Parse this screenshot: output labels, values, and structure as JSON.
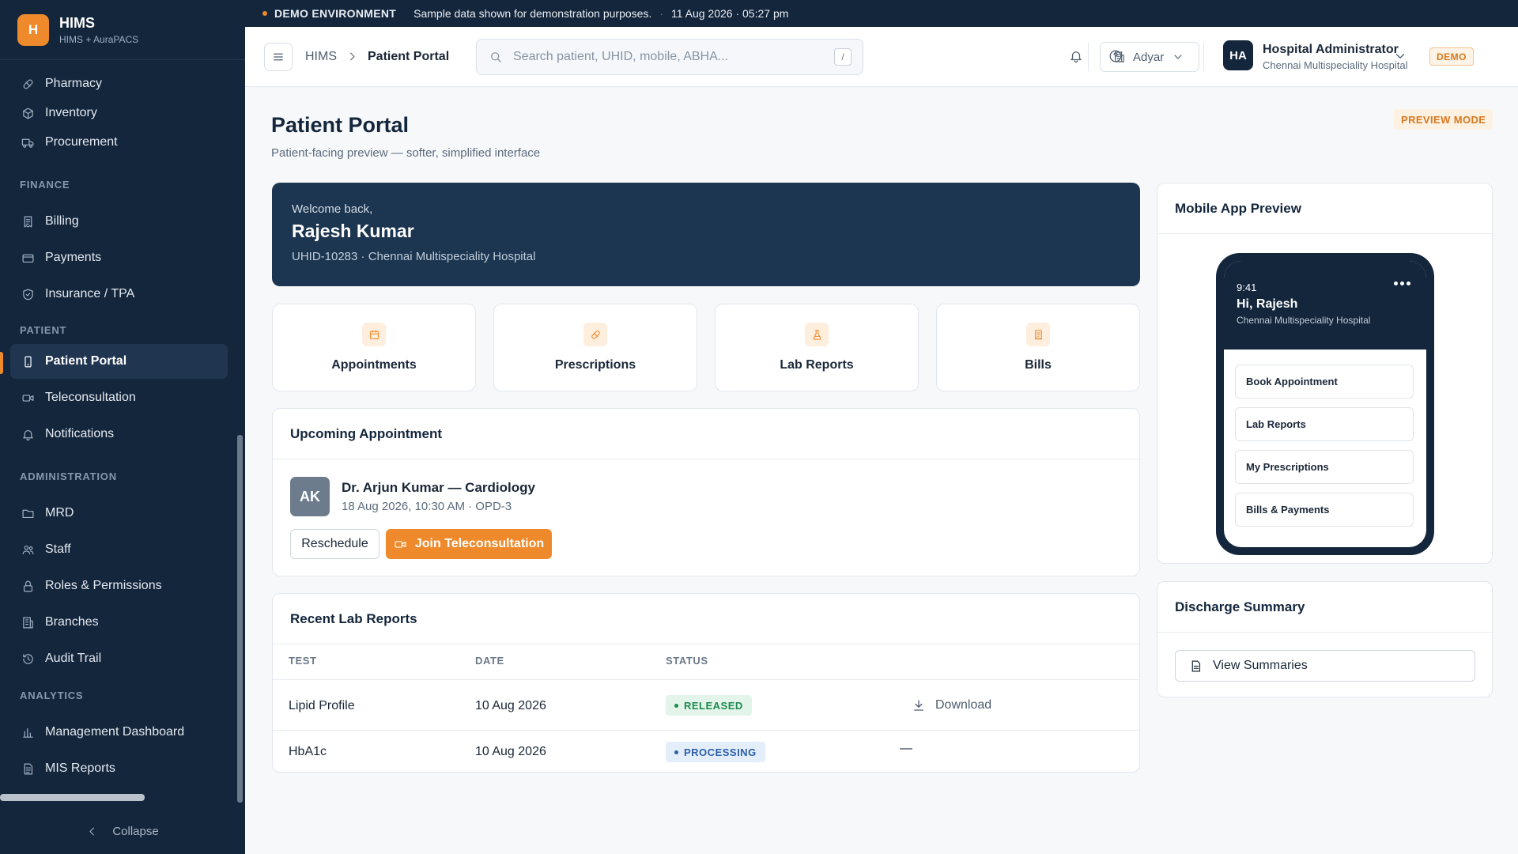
{
  "brand": {
    "logo_letter": "H",
    "name": "HIMS",
    "subtitle": "HIMS + AuraPACS"
  },
  "sidebar": {
    "items_top": [
      {
        "label": "Pharmacy",
        "icon": "pill-icon"
      },
      {
        "label": "Inventory",
        "icon": "box-icon"
      },
      {
        "label": "Procurement",
        "icon": "truck-icon"
      }
    ],
    "sections": {
      "finance": "FINANCE",
      "patient": "PATIENT",
      "administration": "ADMINISTRATION",
      "analytics": "ANALYTICS"
    },
    "finance": [
      {
        "label": "Billing",
        "icon": "receipt-icon"
      },
      {
        "label": "Payments",
        "icon": "wallet-icon"
      },
      {
        "label": "Insurance / TPA",
        "icon": "shield-check-icon"
      }
    ],
    "patient": [
      {
        "label": "Patient Portal",
        "icon": "smartphone-icon",
        "active": true
      },
      {
        "label": "Teleconsultation",
        "icon": "video-icon"
      },
      {
        "label": "Notifications",
        "icon": "bell-icon"
      }
    ],
    "administration": [
      {
        "label": "MRD",
        "icon": "folder-icon"
      },
      {
        "label": "Staff",
        "icon": "users-icon"
      },
      {
        "label": "Roles & Permissions",
        "icon": "lock-icon"
      },
      {
        "label": "Branches",
        "icon": "building-icon"
      },
      {
        "label": "Audit Trail",
        "icon": "history-icon"
      }
    ],
    "analytics": [
      {
        "label": "Management Dashboard",
        "icon": "bar-chart-icon"
      },
      {
        "label": "MIS Reports",
        "icon": "report-icon"
      }
    ],
    "collapse_label": "Collapse"
  },
  "demo_strip": {
    "env": "DEMO ENVIRONMENT",
    "message": "Sample data shown for demonstration purposes.",
    "datetime": "11 Aug 2026 · 05:27 pm"
  },
  "topbar": {
    "breadcrumb_root": "HIMS",
    "breadcrumb_current": "Patient Portal",
    "search_placeholder": "Search patient, UHID, mobile, ABHA...",
    "search_shortcut": "/",
    "branch": "Adyar",
    "user_initials": "HA",
    "user_name": "Hospital Administrator",
    "user_org": "Chennai Multispeciality Hospital",
    "demo_badge": "DEMO"
  },
  "page": {
    "title": "Patient Portal",
    "subtitle": "Patient-facing preview — softer, simplified interface",
    "preview_badge": "PREVIEW MODE"
  },
  "welcome": {
    "greeting": "Welcome back,",
    "name": "Rajesh Kumar",
    "details": "UHID-10283 · Chennai Multispeciality Hospital"
  },
  "tiles": [
    {
      "label": "Appointments",
      "icon": "calendar-icon"
    },
    {
      "label": "Prescriptions",
      "icon": "pill-icon"
    },
    {
      "label": "Lab Reports",
      "icon": "flask-icon"
    },
    {
      "label": "Bills",
      "icon": "receipt-icon"
    }
  ],
  "appointment": {
    "title": "Upcoming Appointment",
    "initials": "AK",
    "doctor": "Dr. Arjun Kumar — Cardiology",
    "time": "18 Aug 2026, 10:30 AM · OPD-3",
    "reschedule": "Reschedule",
    "join": "Join Teleconsultation"
  },
  "lab_reports": {
    "title": "Recent Lab Reports",
    "columns": [
      "TEST",
      "DATE",
      "STATUS"
    ],
    "rows": [
      {
        "test": "Lipid Profile",
        "date": "10 Aug 2026",
        "status": "RELEASED",
        "action": "Download"
      },
      {
        "test": "HbA1c",
        "date": "10 Aug 2026",
        "status": "PROCESSING",
        "action": "—"
      }
    ]
  },
  "mobile_preview": {
    "title": "Mobile App Preview",
    "time": "9:41",
    "greeting": "Hi, Rajesh",
    "hospital": "Chennai Multispeciality Hospital",
    "buttons": [
      "Book Appointment",
      "Lab Reports",
      "My Prescriptions",
      "Bills & Payments"
    ]
  },
  "discharge": {
    "title": "Discharge Summary",
    "button": "View Summaries"
  },
  "colors": {
    "accent": "#ef8a2c",
    "sidebar_bg": "#14263c",
    "released": "#1f8a4f",
    "processing": "#2c5fa8"
  }
}
